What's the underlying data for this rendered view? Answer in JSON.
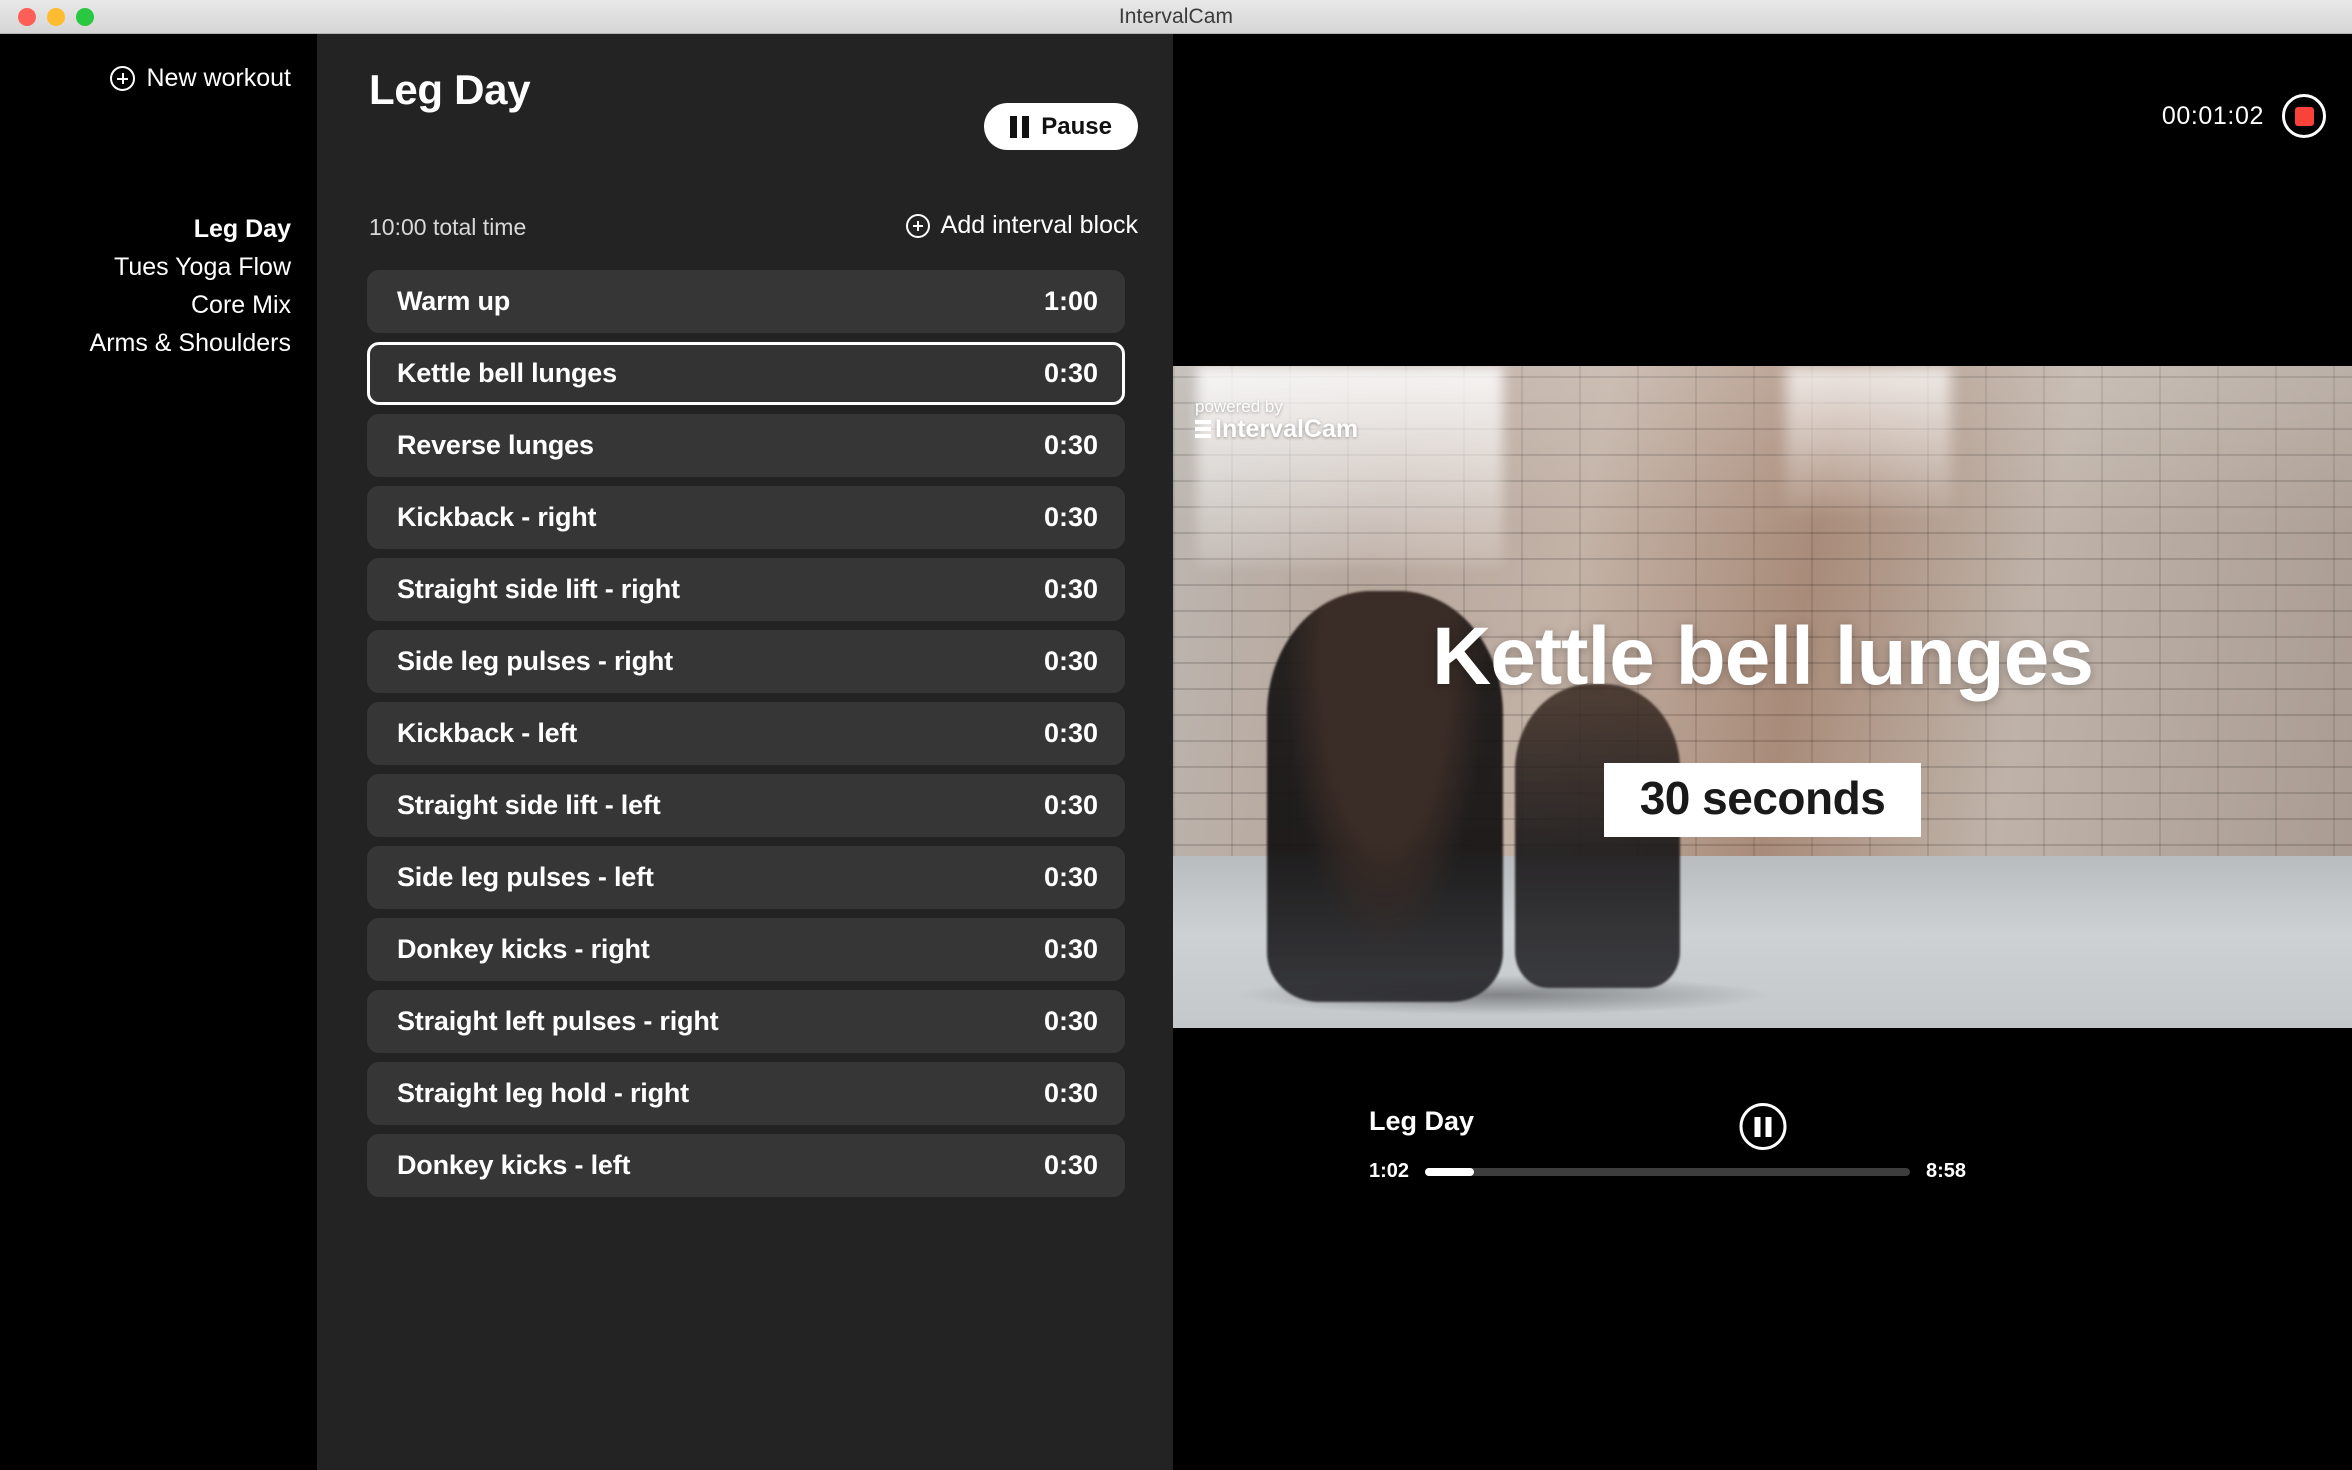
{
  "window": {
    "title": "IntervalCam",
    "traffic_lights": [
      "close-red",
      "minimize-yellow",
      "maximize-green"
    ]
  },
  "sidebar": {
    "new_workout_label": "New workout",
    "new_workout_icon": "plus-circle-icon",
    "items": [
      {
        "label": "Leg Day",
        "active": true
      },
      {
        "label": "Tues Yoga Flow",
        "active": false
      },
      {
        "label": "Core Mix",
        "active": false
      },
      {
        "label": "Arms & Shoulders",
        "active": false
      }
    ]
  },
  "panel": {
    "title": "Leg Day",
    "pause_label": "Pause",
    "pause_icon": "pause-icon",
    "total_time": "10:00 total time",
    "add_block_label": "Add interval block",
    "add_block_icon": "plus-circle-icon",
    "intervals": [
      {
        "name": "Warm up",
        "duration": "1:00",
        "selected": false
      },
      {
        "name": "Kettle bell lunges",
        "duration": "0:30",
        "selected": true
      },
      {
        "name": "Reverse lunges",
        "duration": "0:30",
        "selected": false
      },
      {
        "name": "Kickback - right",
        "duration": "0:30",
        "selected": false
      },
      {
        "name": "Straight side lift - right",
        "duration": "0:30",
        "selected": false
      },
      {
        "name": "Side leg pulses - right",
        "duration": "0:30",
        "selected": false
      },
      {
        "name": "Kickback - left",
        "duration": "0:30",
        "selected": false
      },
      {
        "name": "Straight side lift - left",
        "duration": "0:30",
        "selected": false
      },
      {
        "name": "Side leg pulses - left",
        "duration": "0:30",
        "selected": false
      },
      {
        "name": "Donkey kicks - right",
        "duration": "0:30",
        "selected": false
      },
      {
        "name": "Straight left pulses - right",
        "duration": "0:30",
        "selected": false
      },
      {
        "name": "Straight leg hold - right",
        "duration": "0:30",
        "selected": false
      },
      {
        "name": "Donkey kicks - left",
        "duration": "0:30",
        "selected": false
      }
    ]
  },
  "stage": {
    "recording": {
      "elapsed": "00:01:02",
      "stop_icon": "record-stop-icon",
      "indicator_color": "#f9423a"
    },
    "watermark": {
      "powered_by": "powered by",
      "brand": "IntervalCam"
    },
    "overlay": {
      "title": "Kettle bell lunges",
      "subtitle": "30 seconds"
    },
    "controls": {
      "title": "Leg Day",
      "toggle_icon": "pause-circle-icon",
      "current_time": "1:02",
      "remaining_time": "8:58",
      "progress_percent": 10
    }
  },
  "colors": {
    "sidebar_bg": "#000000",
    "panel_bg": "#232323",
    "row_bg": "#363636",
    "selected_border": "#ffffff",
    "accent_record": "#f9423a"
  }
}
